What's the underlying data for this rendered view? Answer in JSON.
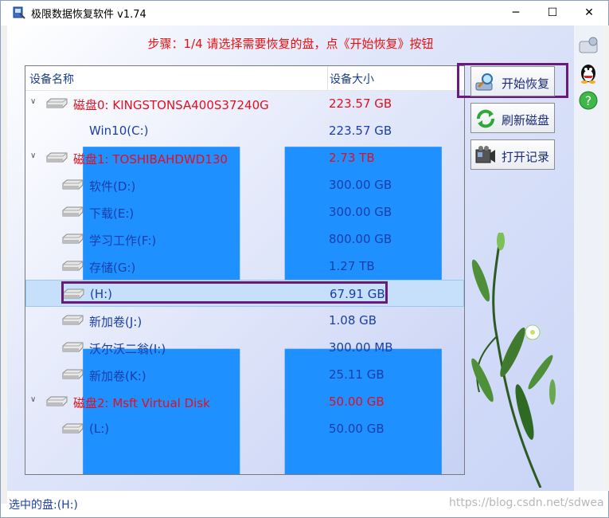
{
  "window": {
    "title": "极限数据恢复软件 v1.74",
    "minimize": "─",
    "maximize": "☐",
    "close": "✕"
  },
  "step_text": "步骤：1/4 请选择需要恢复的盘，点《开始恢复》按钮",
  "table": {
    "col_name": "设备名称",
    "col_size": "设备大小"
  },
  "rows": [
    {
      "type": "disk",
      "name": "磁盘0: KINGSTONSA400S37240G",
      "size": "223.57 GB",
      "color": "red"
    },
    {
      "type": "win",
      "name": "Win10(C:)",
      "size": "223.57 GB",
      "color": "blue"
    },
    {
      "type": "disk",
      "name": "磁盘1: TOSHIBAHDWD130",
      "size": "2.73 TB",
      "color": "red"
    },
    {
      "type": "part",
      "name": " 软件(D:)",
      "size": "300.00 GB",
      "color": "blue"
    },
    {
      "type": "part",
      "name": "下载(E:)",
      "size": "300.00 GB",
      "color": "blue"
    },
    {
      "type": "part",
      "name": "学习工作(F:)",
      "size": "800.00 GB",
      "color": "blue"
    },
    {
      "type": "part",
      "name": "存储(G:)",
      "size": "1.27 TB",
      "color": "blue"
    },
    {
      "type": "part",
      "name": "(H:)",
      "size": "67.91 GB",
      "color": "blue",
      "selected": true
    },
    {
      "type": "part",
      "name": "新加卷(J:)",
      "size": "1.08 GB",
      "color": "blue"
    },
    {
      "type": "part",
      "name": "沃尔沃二翁(I:)",
      "size": "300.00 MB",
      "color": "blue"
    },
    {
      "type": "part",
      "name": "新加卷(K:)",
      "size": "25.11 GB",
      "color": "blue"
    },
    {
      "type": "disk",
      "name": "磁盘2: Msft      Virtual Disk",
      "size": "50.00 GB",
      "color": "red"
    },
    {
      "type": "part",
      "name": "(L:)",
      "size": "50.00 GB",
      "color": "blue"
    }
  ],
  "buttons": {
    "start": "开始恢复",
    "refresh": "刷新磁盘",
    "open_log": "打开记录"
  },
  "status": {
    "selected": "选中的盘:(H:)",
    "watermark": "https://blog.csdn.net/sdwea"
  },
  "colors": {
    "red": "#e01020",
    "blue": "#1a3fa8",
    "highlight": "#6a1a7a"
  }
}
